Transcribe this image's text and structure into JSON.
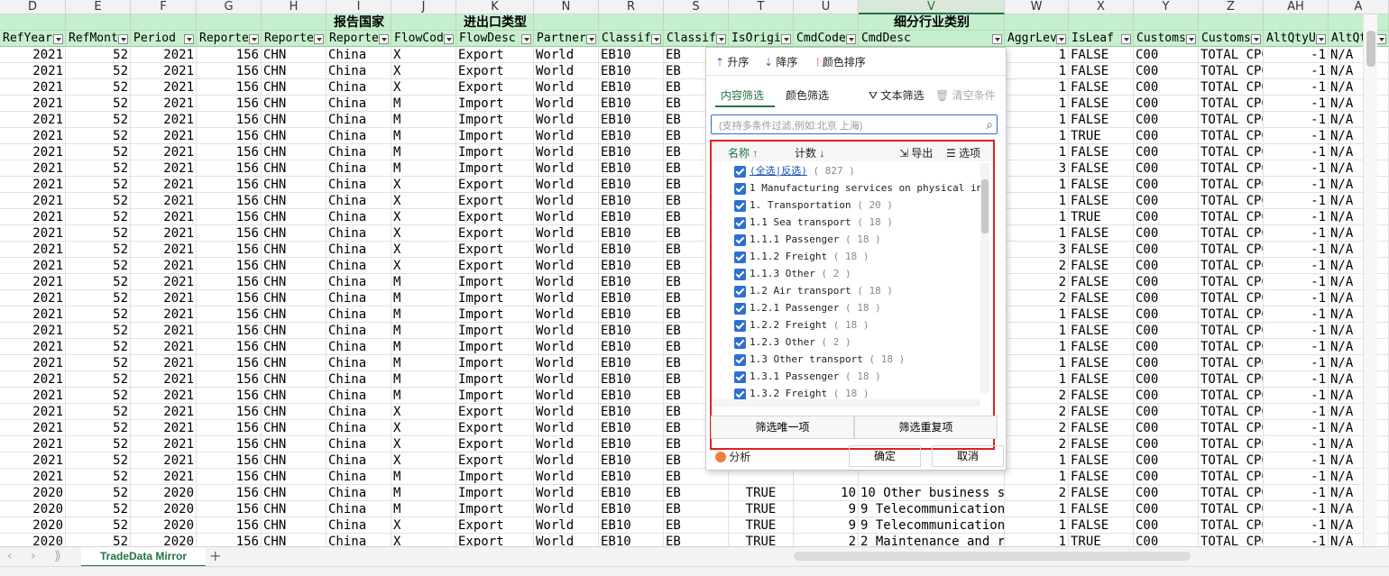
{
  "columns": [
    {
      "letter": "D",
      "header": "RefYear"
    },
    {
      "letter": "E",
      "header": "RefMont"
    },
    {
      "letter": "F",
      "header": "Period"
    },
    {
      "letter": "G",
      "header": "Reporte"
    },
    {
      "letter": "H",
      "header": "Reporte"
    },
    {
      "letter": "I",
      "header": "Reporte"
    },
    {
      "letter": "J",
      "header": "FlowCod"
    },
    {
      "letter": "K",
      "header": "FlowDesc"
    },
    {
      "letter": "N",
      "header": "Partner"
    },
    {
      "letter": "R",
      "header": "Classif"
    },
    {
      "letter": "S",
      "header": "Classif"
    },
    {
      "letter": "T",
      "header": "IsOrigi"
    },
    {
      "letter": "U",
      "header": "CmdCode"
    },
    {
      "letter": "V",
      "header": "CmdDesc"
    },
    {
      "letter": "W",
      "header": "AggrLev"
    },
    {
      "letter": "X",
      "header": "IsLeaf"
    },
    {
      "letter": "Y",
      "header": "Customs"
    },
    {
      "letter": "Z",
      "header": "Customs"
    },
    {
      "letter": "AH",
      "header": "AltQtyU"
    },
    {
      "letter": "A",
      "header": "AltQt"
    }
  ],
  "group_labels": {
    "reporter": "报告国家",
    "flow": "进出口类型",
    "cmd": "细分行业类别"
  },
  "rows": [
    [
      "2021",
      "52",
      "2021",
      "156",
      "CHN",
      "China",
      "X",
      "Export",
      "World",
      "EB10",
      "EB",
      "",
      "",
      "",
      "1",
      "FALSE",
      "C00",
      "TOTAL CPC",
      "-1",
      "N/A"
    ],
    [
      "2021",
      "52",
      "2021",
      "156",
      "CHN",
      "China",
      "X",
      "Export",
      "World",
      "EB10",
      "EB",
      "",
      "",
      "",
      "1",
      "FALSE",
      "C00",
      "TOTAL CPC",
      "-1",
      "N/A"
    ],
    [
      "2021",
      "52",
      "2021",
      "156",
      "CHN",
      "China",
      "X",
      "Export",
      "World",
      "EB10",
      "EB",
      "",
      "",
      "",
      "1",
      "FALSE",
      "C00",
      "TOTAL CPC",
      "-1",
      "N/A"
    ],
    [
      "2021",
      "52",
      "2021",
      "156",
      "CHN",
      "China",
      "M",
      "Import",
      "World",
      "EB10",
      "EB",
      "",
      "",
      "",
      "1",
      "FALSE",
      "C00",
      "TOTAL CPC",
      "-1",
      "N/A"
    ],
    [
      "2021",
      "52",
      "2021",
      "156",
      "CHN",
      "China",
      "M",
      "Import",
      "World",
      "EB10",
      "EB",
      "",
      "",
      "",
      "1",
      "FALSE",
      "C00",
      "TOTAL CPC",
      "-1",
      "N/A"
    ],
    [
      "2021",
      "52",
      "2021",
      "156",
      "CHN",
      "China",
      "M",
      "Import",
      "World",
      "EB10",
      "EB",
      "",
      "",
      "",
      "1",
      "TRUE",
      "C00",
      "TOTAL CPC",
      "-1",
      "N/A"
    ],
    [
      "2021",
      "52",
      "2021",
      "156",
      "CHN",
      "China",
      "M",
      "Import",
      "World",
      "EB10",
      "EB",
      "",
      "",
      "",
      "1",
      "FALSE",
      "C00",
      "TOTAL CPC",
      "-1",
      "N/A"
    ],
    [
      "2021",
      "52",
      "2021",
      "156",
      "CHN",
      "China",
      "M",
      "Import",
      "World",
      "EB10",
      "EB",
      "",
      "",
      "",
      "3",
      "FALSE",
      "C00",
      "TOTAL CPC",
      "-1",
      "N/A"
    ],
    [
      "2021",
      "52",
      "2021",
      "156",
      "CHN",
      "China",
      "X",
      "Export",
      "World",
      "EB10",
      "EB",
      "",
      "",
      "",
      "1",
      "FALSE",
      "C00",
      "TOTAL CPC",
      "-1",
      "N/A"
    ],
    [
      "2021",
      "52",
      "2021",
      "156",
      "CHN",
      "China",
      "X",
      "Export",
      "World",
      "EB10",
      "EB",
      "",
      "",
      "",
      "1",
      "FALSE",
      "C00",
      "TOTAL CPC",
      "-1",
      "N/A"
    ],
    [
      "2021",
      "52",
      "2021",
      "156",
      "CHN",
      "China",
      "X",
      "Export",
      "World",
      "EB10",
      "EB",
      "",
      "",
      "",
      "1",
      "TRUE",
      "C00",
      "TOTAL CPC",
      "-1",
      "N/A"
    ],
    [
      "2021",
      "52",
      "2021",
      "156",
      "CHN",
      "China",
      "X",
      "Export",
      "World",
      "EB10",
      "EB",
      "",
      "",
      "",
      "1",
      "FALSE",
      "C00",
      "TOTAL CPC",
      "-1",
      "N/A"
    ],
    [
      "2021",
      "52",
      "2021",
      "156",
      "CHN",
      "China",
      "X",
      "Export",
      "World",
      "EB10",
      "EB",
      "",
      "",
      "",
      "3",
      "FALSE",
      "C00",
      "TOTAL CPC",
      "-1",
      "N/A"
    ],
    [
      "2021",
      "52",
      "2021",
      "156",
      "CHN",
      "China",
      "X",
      "Export",
      "World",
      "EB10",
      "EB",
      "",
      "",
      "",
      "2",
      "FALSE",
      "C00",
      "TOTAL CPC",
      "-1",
      "N/A"
    ],
    [
      "2021",
      "52",
      "2021",
      "156",
      "CHN",
      "China",
      "M",
      "Import",
      "World",
      "EB10",
      "EB",
      "",
      "",
      "",
      "2",
      "FALSE",
      "C00",
      "TOTAL CPC",
      "-1",
      "N/A"
    ],
    [
      "2021",
      "52",
      "2021",
      "156",
      "CHN",
      "China",
      "M",
      "Import",
      "World",
      "EB10",
      "EB",
      "",
      "",
      "",
      "2",
      "FALSE",
      "C00",
      "TOTAL CPC",
      "-1",
      "N/A"
    ],
    [
      "2021",
      "52",
      "2021",
      "156",
      "CHN",
      "China",
      "M",
      "Import",
      "World",
      "EB10",
      "EB",
      "",
      "",
      "",
      "1",
      "FALSE",
      "C00",
      "TOTAL CPC",
      "-1",
      "N/A"
    ],
    [
      "2021",
      "52",
      "2021",
      "156",
      "CHN",
      "China",
      "M",
      "Import",
      "World",
      "EB10",
      "EB",
      "",
      "",
      "",
      "1",
      "FALSE",
      "C00",
      "TOTAL CPC",
      "-1",
      "N/A"
    ],
    [
      "2021",
      "52",
      "2021",
      "156",
      "CHN",
      "China",
      "M",
      "Import",
      "World",
      "EB10",
      "EB",
      "",
      "",
      "",
      "1",
      "FALSE",
      "C00",
      "TOTAL CPC",
      "-1",
      "N/A"
    ],
    [
      "2021",
      "52",
      "2021",
      "156",
      "CHN",
      "China",
      "M",
      "Import",
      "World",
      "EB10",
      "EB",
      "",
      "",
      "",
      "1",
      "FALSE",
      "C00",
      "TOTAL CPC",
      "-1",
      "N/A"
    ],
    [
      "2021",
      "52",
      "2021",
      "156",
      "CHN",
      "China",
      "M",
      "Import",
      "World",
      "EB10",
      "EB",
      "",
      "",
      "",
      "1",
      "FALSE",
      "C00",
      "TOTAL CPC",
      "-1",
      "N/A"
    ],
    [
      "2021",
      "52",
      "2021",
      "156",
      "CHN",
      "China",
      "M",
      "Import",
      "World",
      "EB10",
      "EB",
      "",
      "",
      "",
      "2",
      "FALSE",
      "C00",
      "TOTAL CPC",
      "-1",
      "N/A"
    ],
    [
      "2021",
      "52",
      "2021",
      "156",
      "CHN",
      "China",
      "X",
      "Export",
      "World",
      "EB10",
      "EB",
      "",
      "",
      "",
      "2",
      "FALSE",
      "C00",
      "TOTAL CPC",
      "-1",
      "N/A"
    ],
    [
      "2021",
      "52",
      "2021",
      "156",
      "CHN",
      "China",
      "X",
      "Export",
      "World",
      "EB10",
      "EB",
      "",
      "",
      "",
      "2",
      "FALSE",
      "C00",
      "TOTAL CPC",
      "-1",
      "N/A"
    ],
    [
      "2021",
      "52",
      "2021",
      "156",
      "CHN",
      "China",
      "X",
      "Export",
      "World",
      "EB10",
      "EB",
      "",
      "",
      "",
      "2",
      "FALSE",
      "C00",
      "TOTAL CPC",
      "-1",
      "N/A"
    ],
    [
      "2021",
      "52",
      "2021",
      "156",
      "CHN",
      "China",
      "X",
      "Export",
      "World",
      "EB10",
      "EB",
      "",
      "",
      "",
      "1",
      "FALSE",
      "C00",
      "TOTAL CPC",
      "-1",
      "N/A"
    ],
    [
      "2021",
      "52",
      "2021",
      "156",
      "CHN",
      "China",
      "M",
      "Import",
      "World",
      "EB10",
      "EB",
      "",
      "",
      "",
      "1",
      "FALSE",
      "C00",
      "TOTAL CPC",
      "-1",
      "N/A"
    ],
    [
      "2020",
      "52",
      "2020",
      "156",
      "CHN",
      "China",
      "M",
      "Import",
      "World",
      "EB10",
      "EB",
      "TRUE",
      "10",
      "10 Other business se",
      "2",
      "FALSE",
      "C00",
      "TOTAL CPC",
      "-1",
      "N/A"
    ],
    [
      "2020",
      "52",
      "2020",
      "156",
      "CHN",
      "China",
      "M",
      "Import",
      "World",
      "EB10",
      "EB",
      "TRUE",
      "9",
      "9 Telecommunications",
      "1",
      "FALSE",
      "C00",
      "TOTAL CPC",
      "-1",
      "N/A"
    ],
    [
      "2020",
      "52",
      "2020",
      "156",
      "CHN",
      "China",
      "X",
      "Export",
      "World",
      "EB10",
      "EB",
      "TRUE",
      "9",
      "9 Telecommunications",
      "1",
      "FALSE",
      "C00",
      "TOTAL CPC",
      "-1",
      "N/A"
    ],
    [
      "2020",
      "52",
      "2020",
      "156",
      "CHN",
      "China",
      "X",
      "Export",
      "World",
      "EB10",
      "EB",
      "TRUE",
      "2",
      "2 Maintenance and re",
      "1",
      "TRUE",
      "C00",
      "TOTAL CPC",
      "-1",
      "N/A"
    ],
    [
      "2020",
      "52",
      "2020",
      "156",
      "CHN",
      "China",
      "M",
      "Import",
      "World",
      "EB10",
      "EB",
      "TRUE",
      "1",
      "1 Manufacturing serv",
      "1",
      "FALSE",
      "C00",
      "TOTAL CPC",
      "-1",
      "N/A"
    ]
  ],
  "filter_popup": {
    "sort_asc": "升序",
    "sort_desc": "降序",
    "sort_color": "颜色排序",
    "tab_content": "内容筛选",
    "tab_color": "颜色筛选",
    "text_filter": "文本筛选",
    "clear": "清空条件",
    "search_placeholder": "(支持多条件过滤,例如:北京 上海)",
    "col_name": "名称",
    "col_count": "计数",
    "export": "导出",
    "options": "选项",
    "select_all": "(全选|反选)",
    "select_all_count": "( 827 )",
    "items": [
      {
        "label": "1 Manufacturing services on physical inputs",
        "count": ""
      },
      {
        "label": "1. Transportation",
        "count": "( 20 )"
      },
      {
        "label": "1.1 Sea transport",
        "count": "( 18 )"
      },
      {
        "label": "1.1.1 Passenger",
        "count": "( 18 )"
      },
      {
        "label": "1.1.2 Freight",
        "count": "( 18 )"
      },
      {
        "label": "1.1.3 Other",
        "count": "( 2 )"
      },
      {
        "label": "1.2 Air transport",
        "count": "( 18 )"
      },
      {
        "label": "1.2.1 Passenger",
        "count": "( 18 )"
      },
      {
        "label": "1.2.2 Freight",
        "count": "( 18 )"
      },
      {
        "label": "1.2.3 Other",
        "count": "( 2 )"
      },
      {
        "label": "1.3 Other transport",
        "count": "( 18 )"
      },
      {
        "label": "1.3.1 Passenger",
        "count": "( 18 )"
      },
      {
        "label": "1.3.2 Freight",
        "count": "( 18 )"
      }
    ],
    "unique_btn": "筛选唯一项",
    "dup_btn": "筛选重复项",
    "analyze": "分析",
    "ok": "确定",
    "cancel": "取消"
  },
  "sheet_tab": "TradeData Mirror",
  "colors": {
    "accent": "#217346",
    "header_green": "#c6efce",
    "highlight": "#e02020",
    "checkbox": "#2e6fd1"
  }
}
